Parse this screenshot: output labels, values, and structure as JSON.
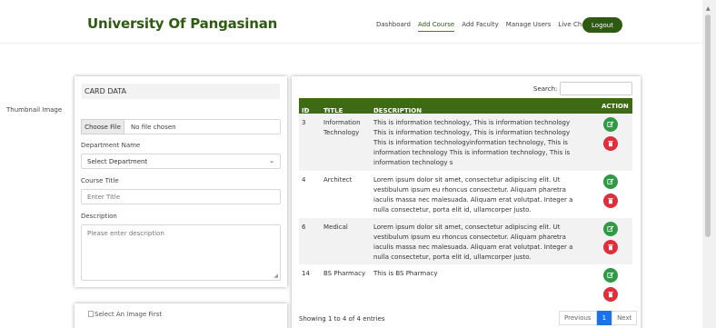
{
  "header": {
    "brand": "University Of Pangasinan",
    "nav": [
      "Dashboard",
      "Add Course",
      "Add Faculty",
      "Manage Users",
      "Live Chat"
    ],
    "active_nav": "Add Course",
    "logout": "Logout"
  },
  "form": {
    "card_title": "CARD DATA",
    "thumbnail_label": "Thumbnail Image",
    "choose_file": "Choose File",
    "no_file": "No file chosen",
    "department_label": "Department Name",
    "department_value": "Select Department",
    "course_title_label": "Course Title",
    "course_title_placeholder": "Enter Title",
    "description_label": "Description",
    "description_placeholder": "Please enter description",
    "image_alt": "Select An Image First"
  },
  "table": {
    "search_label": "Search:",
    "columns": [
      "ID",
      "TITLE",
      "DESCRIPTION",
      "ACTION"
    ],
    "rows": [
      {
        "id": "3",
        "title": "Information Technology",
        "description": "This is information technology, This is information technology This is information technology, This is information technology This is information technologyinformation technology, This is information technology This is information technology, This is information technology s"
      },
      {
        "id": "4",
        "title": "Architect",
        "description": "Lorem ipsum dolor sit amet, consectetur adipiscing elit. Ut vestibulum ipsum eu rhoncus consectetur. Aliquam pharetra iaculis massa nec malesuada. Aliquam erat volutpat. Integer a nulla consectetur, porta elit id, ullamcorper justo."
      },
      {
        "id": "6",
        "title": "Medical",
        "description": "Lorem ipsum dolor sit amet, consectetur adipiscing elit. Ut vestibulum ipsum eu rhoncus consectetur. Aliquam pharetra iaculis massa nec malesuada. Aliquam erat volutpat. Integer a nulla consectetur, porta elit id, ullamcorper justo."
      },
      {
        "id": "14",
        "title": "BS Pharmacy",
        "description": "This is BS Pharmacy"
      }
    ],
    "info": "Showing 1 to 4 of 4 entries",
    "pager": {
      "prev": "Previous",
      "page": "1",
      "next": "Next"
    }
  },
  "icons": {
    "edit": "edit-icon",
    "delete": "trash-icon"
  },
  "colors": {
    "brand": "#2f5a14",
    "table_header": "#3d6a12",
    "edit": "#2e9a45",
    "delete": "#e02e3d",
    "pager_active": "#1a73e8"
  }
}
